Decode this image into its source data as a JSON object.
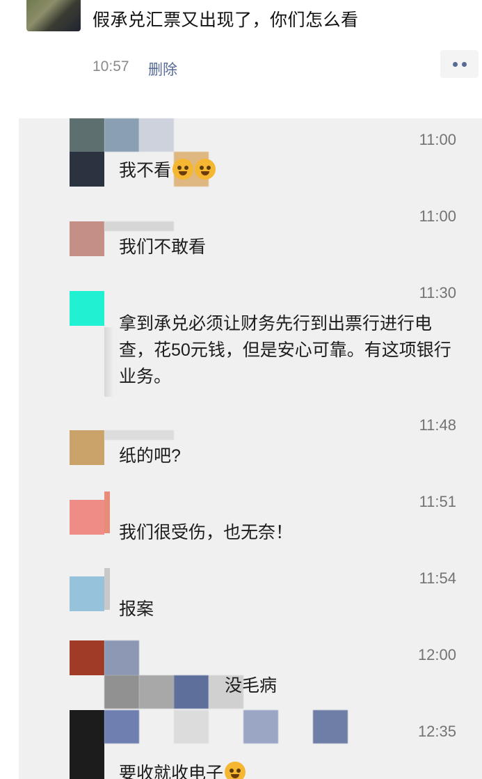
{
  "post": {
    "text": "假承兑汇票又出现了，你们怎么看",
    "time": "10:57",
    "delete_label": "删除",
    "more_icon": "more-dots-icon"
  },
  "comments": [
    {
      "time": "11:00",
      "text": "我不看",
      "emojis": 2,
      "avatar_color": "#2b3240"
    },
    {
      "time": "11:00",
      "text": "我们不敢看",
      "emojis": 0,
      "avatar_color": "#c48f84"
    },
    {
      "time": "11:30",
      "text": "拿到承兑必须让财务先行到出票行进行电查，花50元钱，但是安心可靠。有这项银行业务。",
      "emojis": 0,
      "avatar_color": "#22f0d2"
    },
    {
      "time": "11:48",
      "text": "纸的吧?",
      "emojis": 0,
      "avatar_color": "#c9a36a"
    },
    {
      "time": "11:51",
      "text": "我们很受伤，也无奈！",
      "emojis": 0,
      "avatar_color": "#ee8d86"
    },
    {
      "time": "11:54",
      "text": "报案",
      "emojis": 0,
      "avatar_color": "#96c2dc"
    },
    {
      "time": "12:00",
      "text": "没毛病",
      "emojis": 0,
      "avatar_color": "#a03b28"
    },
    {
      "time": "12:35",
      "text": "要收就收电子",
      "emojis": 1,
      "avatar_color": "#1c1c1c"
    }
  ],
  "colors": {
    "link": "#576b95",
    "time": "#8a8a8a",
    "comment_bg": "#f0f0f0"
  }
}
